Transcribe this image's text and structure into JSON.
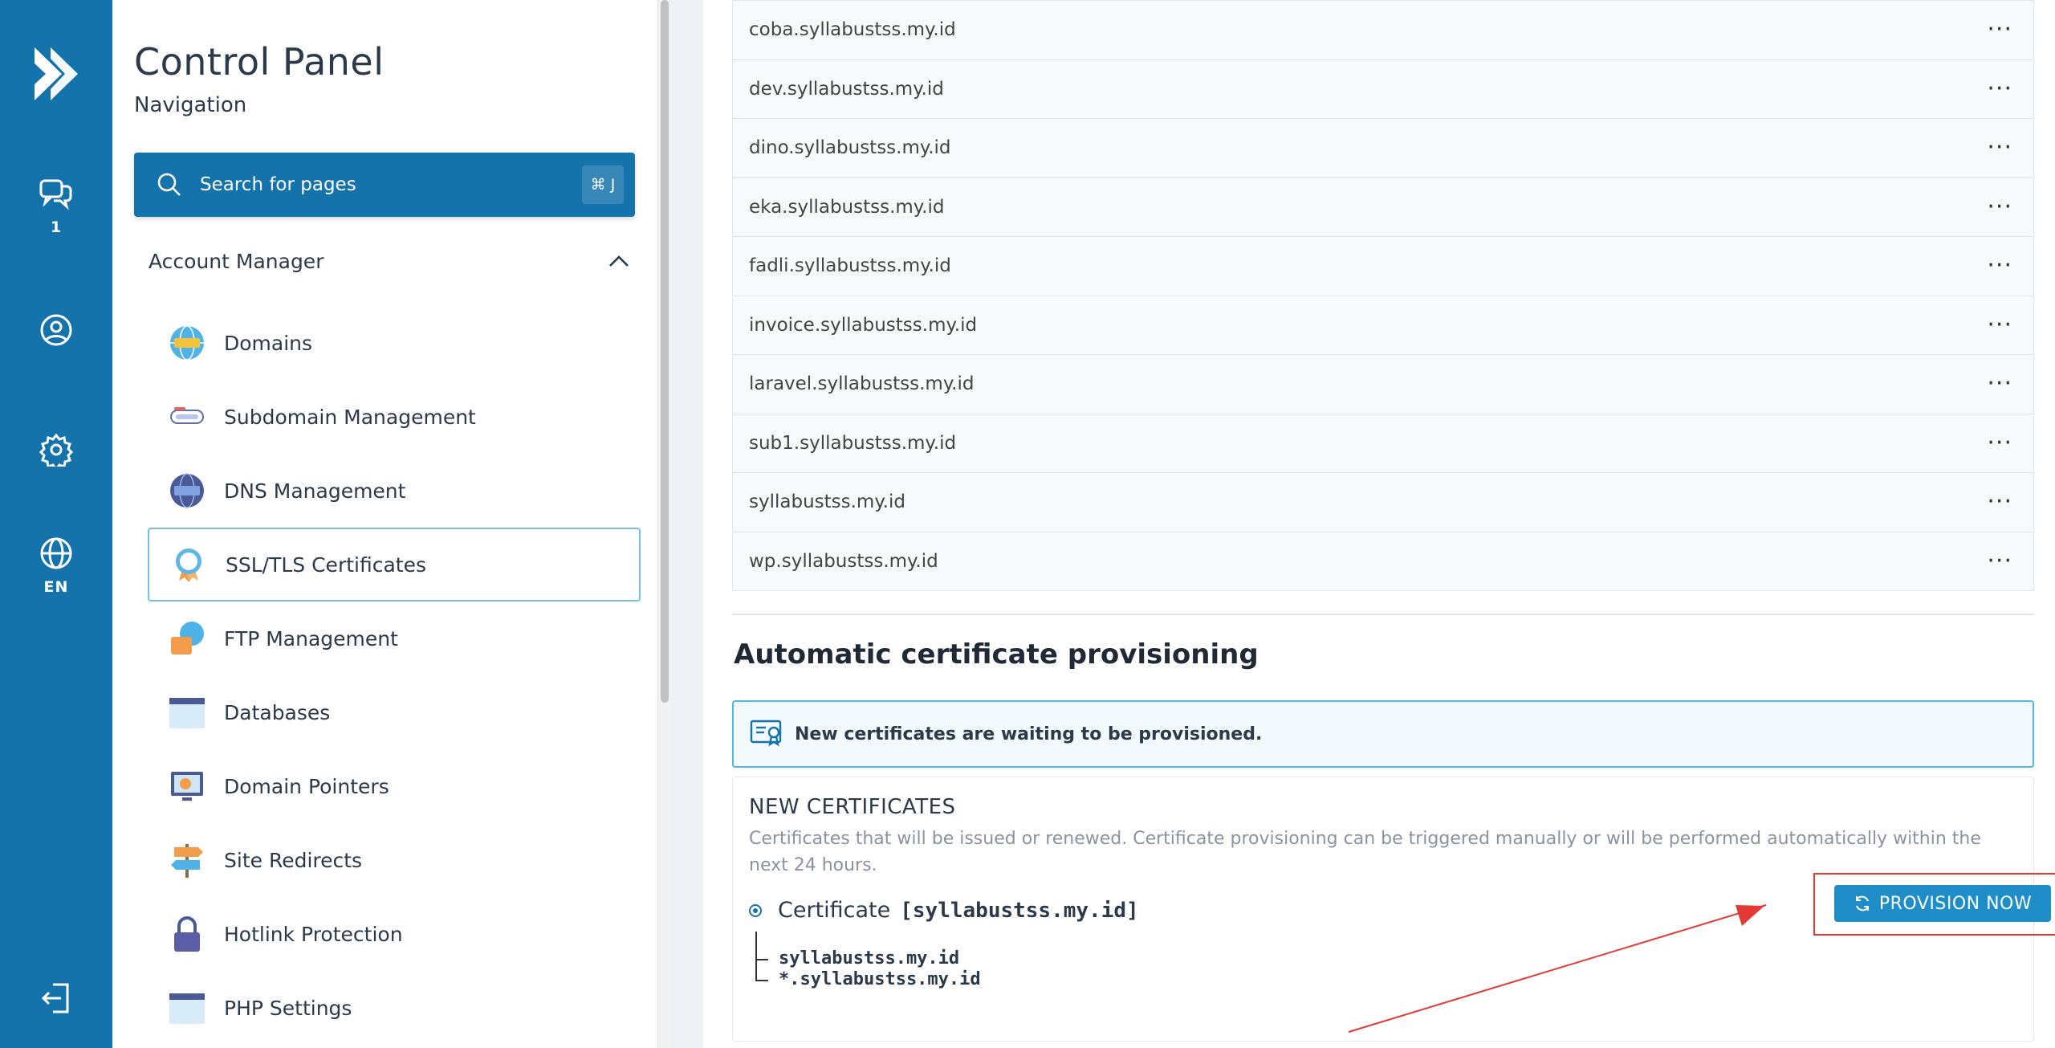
{
  "rail": {
    "chat_badge": "1",
    "language": "EN"
  },
  "nav": {
    "title": "Control Panel",
    "subtitle": "Navigation",
    "search_placeholder": "Search for pages",
    "search_shortcut": "⌘ J",
    "section": "Account Manager",
    "items": [
      {
        "label": "Domains",
        "icon": "domains-icon"
      },
      {
        "label": "Subdomain Management",
        "icon": "subdomain-icon"
      },
      {
        "label": "DNS Management",
        "icon": "dns-icon"
      },
      {
        "label": "SSL/TLS Certificates",
        "icon": "ssl-icon",
        "active": true
      },
      {
        "label": "FTP Management",
        "icon": "ftp-icon"
      },
      {
        "label": "Databases",
        "icon": "sql-icon"
      },
      {
        "label": "Domain Pointers",
        "icon": "domain-pointers-icon"
      },
      {
        "label": "Site Redirects",
        "icon": "signpost-icon"
      },
      {
        "label": "Hotlink Protection",
        "icon": "lock-icon"
      },
      {
        "label": "PHP Settings",
        "icon": "php-icon"
      }
    ]
  },
  "domains": [
    "coba.syllabustss.my.id",
    "dev.syllabustss.my.id",
    "dino.syllabustss.my.id",
    "eka.syllabustss.my.id",
    "fadli.syllabustss.my.id",
    "invoice.syllabustss.my.id",
    "laravel.syllabustss.my.id",
    "sub1.syllabustss.my.id",
    "syllabustss.my.id",
    "wp.syllabustss.my.id"
  ],
  "provisioning": {
    "heading": "Automatic certificate provisioning",
    "alert": "New certificates are waiting to be provisioned.",
    "card_title": "NEW CERTIFICATES",
    "card_desc": "Certificates that will be issued or renewed. Certificate provisioning can be triggered manually or will be performed automatically within the next 24 hours.",
    "cert_label": "Certificate",
    "cert_name": "[syllabustss.my.id]",
    "leaves": [
      "syllabustss.my.id",
      "*.syllabustss.my.id"
    ],
    "button": "PROVISION NOW"
  },
  "colors": {
    "brand": "#1573ab",
    "button": "#1f8dc7",
    "annotation": "#e53935"
  }
}
